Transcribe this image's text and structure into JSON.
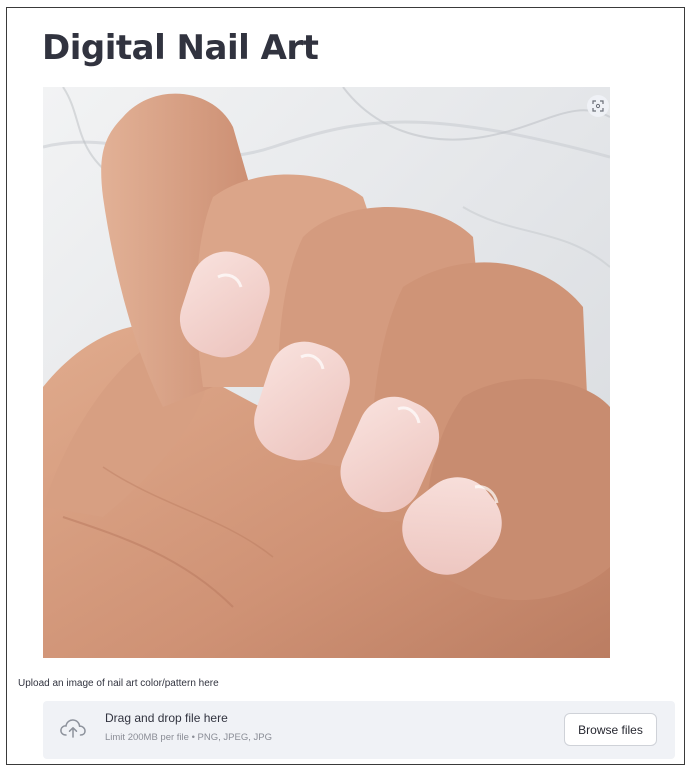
{
  "page": {
    "title": "Digital Nail Art"
  },
  "image": {
    "alt": "hand with pink nails",
    "fullscreen_icon": "fullscreen-icon"
  },
  "uploader": {
    "label": "Upload an image of nail art color/pattern here",
    "drop_text": "Drag and drop file here",
    "limit_text": "Limit 200MB per file • PNG, JPEG, JPG",
    "browse_label": "Browse files",
    "icon": "cloud-upload-icon"
  },
  "colors": {
    "nail": "#f3d3cf",
    "skin": "#d39a7c",
    "background_marble": "#e6e8ea",
    "uploader_bg": "#f0f2f6"
  }
}
